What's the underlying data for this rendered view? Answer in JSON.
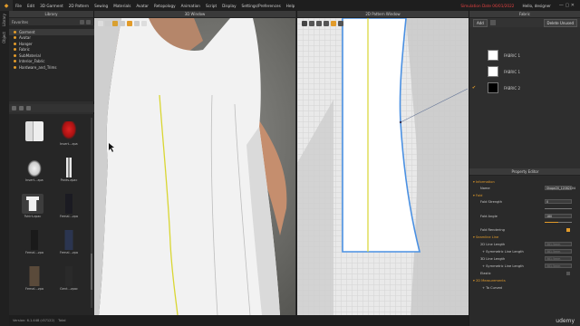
{
  "menu": [
    "File",
    "Edit",
    "3D Garment",
    "2D Pattern",
    "Sewing",
    "Materials",
    "Avatar",
    "Retopology",
    "Animation",
    "Script",
    "Display",
    "Settings/Preferences",
    "Help"
  ],
  "menu_right": {
    "status": "Simulation Date 06/01/2022",
    "user": "Hello, designer"
  },
  "left_strip": [
    "Library",
    "Object"
  ],
  "library": {
    "title": "Library",
    "favorites_label": "Favorites",
    "tree": [
      "Garment",
      "Avatar",
      "Hanger",
      "Fabric",
      "SubMaterial",
      "Interior_Fabric",
      "Hardware_and_Trims"
    ],
    "thumbs": [
      {
        "cap": ""
      },
      {
        "cap": "Insert...zpac"
      },
      {
        "cap": "Insert...zpac"
      },
      {
        "cap": "Pants.zpac"
      },
      {
        "cap": "Tshirt.zpac"
      },
      {
        "cap": "Femal...zpac"
      },
      {
        "cap": "Femal...zpac"
      },
      {
        "cap": "Femal...zpac"
      },
      {
        "cap": "Femal...zpac"
      },
      {
        "cap": "Gent...zpac"
      }
    ]
  },
  "window3d": {
    "title": "3D Window"
  },
  "window2d": {
    "title": "2D Pattern Window"
  },
  "fabric": {
    "title": "Fabric",
    "add": "Add",
    "delete_unused": "Delete Unused",
    "items": [
      {
        "name": "FABRIC 1",
        "color": "#ffffff",
        "checked": false
      },
      {
        "name": "FABRIC 1",
        "color": "#ffffff",
        "checked": false
      },
      {
        "name": "FABRIC 2",
        "color": "#000000",
        "checked": true
      }
    ]
  },
  "property_editor": {
    "title": "Property Editor",
    "information_label": "Information",
    "name_label": "Name",
    "name_value": "Shape20_12082104",
    "fold_label": "Fold",
    "fold_strength_label": "Fold Strength",
    "fold_strength_value": "0",
    "fold_angle_label": "Fold Angle",
    "fold_angle_value": "180",
    "fold_angle_level": 0.5,
    "fold_rendering_label": "Fold Rendering",
    "seamline_label": "Seamline Line",
    "line_length_2d_label": "2D Line Length",
    "line_length_2d_value": "381.5mm",
    "sym_length_2d_label": "Symmetric Line Length",
    "sym_length_2d_value": "381.5mm",
    "line_length_3d_label": "3D Line Length",
    "line_length_3d_value": "381.5mm",
    "sym_length_3d_label": "Symmetric Line Length",
    "sym_length_3d_value": "381.5mm",
    "elastic_label": "Elastic",
    "measurements_label": "2D Measurements",
    "to_curved_label": "To Curved"
  },
  "status": {
    "version": "Version: 6.1.448 (r37122)",
    "extra": "Total"
  },
  "watermark": "udemy",
  "colors": {
    "accent": "#e29b2a",
    "seam": "#d9d632",
    "outline": "#4a90e2"
  }
}
